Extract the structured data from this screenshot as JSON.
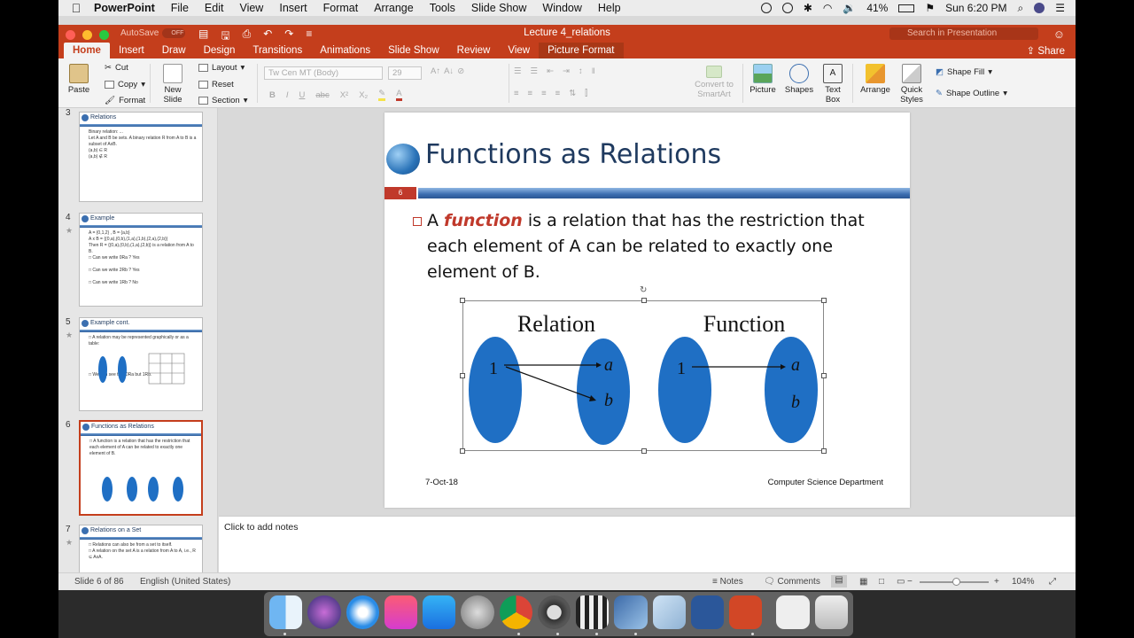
{
  "menubar": {
    "app": "PowerPoint",
    "items": [
      "File",
      "Edit",
      "View",
      "Insert",
      "Format",
      "Arrange",
      "Tools",
      "Slide Show",
      "Window",
      "Help"
    ],
    "battery": "41%",
    "clock": "Sun 6:20 PM"
  },
  "titlebar": {
    "autosave": "AutoSave",
    "autosave_state": "OFF",
    "doc_title": "Lecture 4_relations",
    "search_placeholder": "Search in Presentation",
    "share": "Share"
  },
  "tabs": [
    "Home",
    "Insert",
    "Draw",
    "Design",
    "Transitions",
    "Animations",
    "Slide Show",
    "Review",
    "View",
    "Picture Format"
  ],
  "ribbon": {
    "paste": "Paste",
    "cut": "Cut",
    "copy": "Copy",
    "format": "Format",
    "new_slide_1": "New",
    "new_slide_2": "Slide",
    "layout": "Layout",
    "reset": "Reset",
    "section": "Section",
    "font_name": "Tw Cen MT (Body)",
    "font_size": "29",
    "convert_1": "Convert to",
    "convert_2": "SmartArt",
    "picture": "Picture",
    "shapes": "Shapes",
    "text_box_1": "Text",
    "text_box_2": "Box",
    "arrange": "Arrange",
    "quick_styles_1": "Quick",
    "quick_styles_2": "Styles",
    "shape_fill": "Shape Fill",
    "shape_outline": "Shape Outline"
  },
  "thumbnails": [
    {
      "num": "3",
      "title": "Relations",
      "text": "Binary relation: ...\nLet A and B be sets. A binary relation R from A to B is a subset of AxB.\n(a,b) ∈ R\n(a,b) ∉ R"
    },
    {
      "num": "4",
      "title": "Example",
      "text": "A = {0,1,2} , B = {a,b}\nA x B = {(0,a),(0,b),(1,a),(1,b),(2,a),(2,b)}\nThen R = {(0,a),(0,b),(1,a),(2,b)} is a relation from A to B.\n□ Can we write 0Ra ? Yes\n\n□ Can we write 2Rb ? Yes\n\n□ Can we write 1Rb ? No"
    },
    {
      "num": "5",
      "title": "Example cont.",
      "text": "□ A relation may be represented graphically or as a table:\n\n\n\n\n□ We can see that 0Ra but 1Rb."
    },
    {
      "num": "6",
      "title": "Functions as Relations",
      "text": "□ A function is a relation that has the restriction that each element of A can be related to exactly one element of B."
    },
    {
      "num": "7",
      "title": "Relations on a Set",
      "text": "□ Relations can also be from a set to itself.\n□ A relation on the set A is a relation from A to A, i.e., R ⊆ AxA."
    }
  ],
  "slide": {
    "title": "Functions as Relations",
    "number": "6",
    "bullet_prefix": "A",
    "bullet_keyword": "function",
    "bullet_rest": "is a relation that has the restriction that each element of A can be related to exactly one element of B.",
    "footer_date": "7-Oct-18",
    "footer_dept": "Computer Science Department",
    "diagram": {
      "left_title": "Relation",
      "right_title": "Function",
      "domain_label": "1",
      "codomain_a": "a",
      "codomain_b": "b"
    }
  },
  "notes_placeholder": "Click to add notes",
  "statusbar": {
    "slide_info": "Slide 6 of 86",
    "language": "English (United States)",
    "notes": "Notes",
    "comments": "Comments",
    "zoom": "104%",
    "zoom_level": 0.52
  },
  "colors": {
    "accent": "#c43e1c",
    "title_blue": "#1f3a5f",
    "ellipse_blue": "#1f6fc4"
  }
}
